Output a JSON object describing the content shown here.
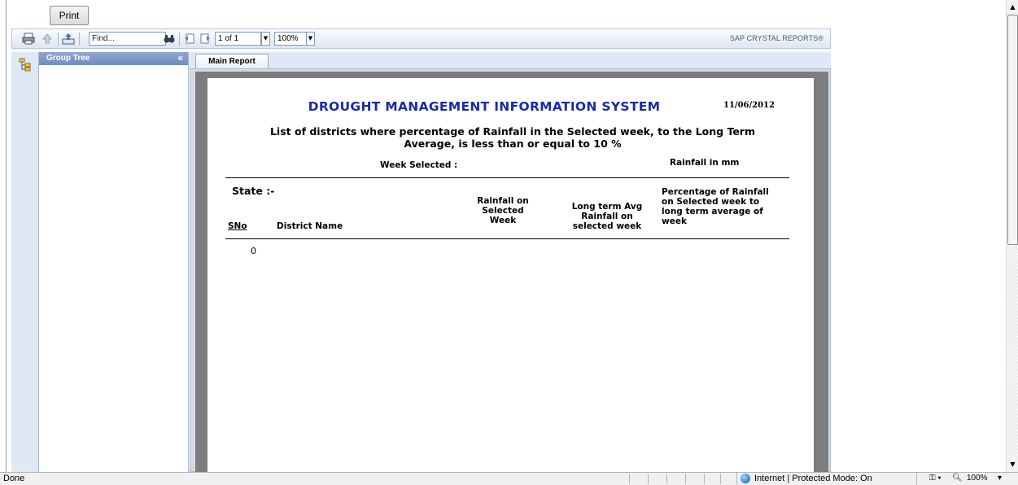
{
  "toolbar": {
    "print_label": "Print",
    "find_placeholder": "Find...",
    "page_indicator": "1 of 1",
    "zoom": "100%",
    "brand": "SAP CRYSTAL REPORTS®"
  },
  "group_tree": {
    "title": "Group Tree",
    "collapse_glyph": "«"
  },
  "tabs": [
    {
      "label": "Main Report"
    }
  ],
  "report": {
    "title": "DROUGHT MANAGEMENT INFORMATION SYSTEM",
    "date": "11/06/2012",
    "subtitle_line1": "List of districts where percentage of Rainfall in the Selected week, to the Long Term",
    "subtitle_line2": "Average,  is less than or equal to 10 %",
    "week_selected_label": "Week Selected :",
    "unit_label": "Rainfall in mm",
    "state_label": "State :-",
    "columns": {
      "sno": "SNo",
      "district": "District Name",
      "rainfall_selected_1": "Rainfall on",
      "rainfall_selected_2": "Selected",
      "rainfall_selected_3": "Week",
      "lta_1": "Long term Avg",
      "lta_2": "Rainfall on",
      "lta_3": "selected week",
      "pct_1": "Percentage of Rainfall",
      "pct_2": "on Selected week to",
      "pct_3": "long term average of",
      "pct_4": "week"
    },
    "rows": [
      {
        "sno": "0"
      }
    ]
  },
  "statusbar": {
    "status": "Done",
    "zone": "Internet | Protected Mode: On",
    "zoom": "100%"
  },
  "icons": [
    "print-icon",
    "export-icon",
    "upload-icon",
    "binoculars-icon",
    "prev-page-icon",
    "next-page-icon",
    "group-tree-icon",
    "globe-icon",
    "magnifier-icon"
  ]
}
